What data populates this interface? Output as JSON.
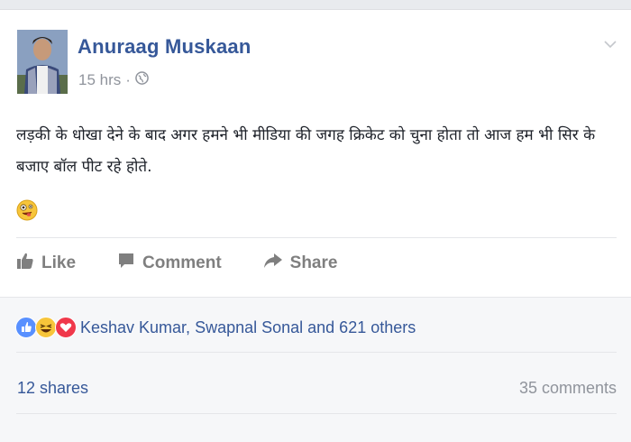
{
  "post": {
    "author": "Anuraag Muskaan",
    "time": "15 hrs",
    "separator": "·",
    "privacy_icon": "globe-icon",
    "text": "लड़की के धोखा देने के बाद अगर हमने भी मीडिया की जगह क्रिकेट को चुना होता तो आज हम भी सिर के बजाए बॉल पीट रहे होते.",
    "emoji": "crazy-face-emoji"
  },
  "actions": {
    "like": "Like",
    "comment": "Comment",
    "share": "Share"
  },
  "reactions": {
    "icons": [
      "like-reaction-icon",
      "haha-reaction-icon",
      "love-reaction-icon"
    ],
    "text": "Keshav Kumar, Swapnal Sonal and 621 others"
  },
  "stats": {
    "shares": "12 shares",
    "comments": "35 comments"
  },
  "colors": {
    "link": "#365899",
    "muted": "#90949c",
    "action": "#7f7f7f"
  }
}
